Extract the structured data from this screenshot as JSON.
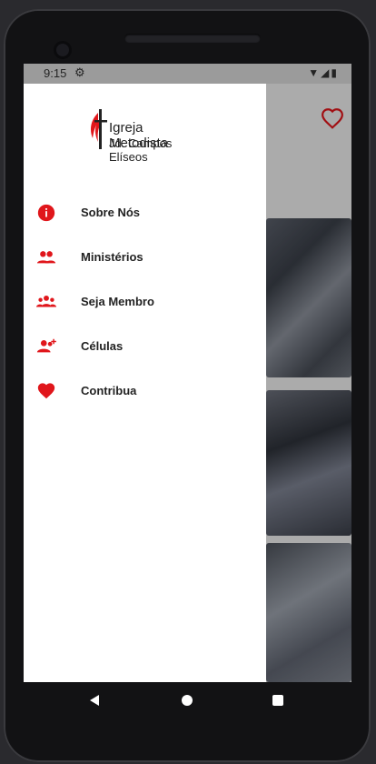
{
  "status": {
    "time": "9:15"
  },
  "logo": {
    "title": "Igreja Metodista",
    "subtitle": "Jd. Campos Elíseos"
  },
  "menu": {
    "items": [
      {
        "label": "Sobre Nós",
        "icon": "info-icon"
      },
      {
        "label": "Ministérios",
        "icon": "people-icon"
      },
      {
        "label": "Seja Membro",
        "icon": "group-icon"
      },
      {
        "label": "Células",
        "icon": "person-add-icon"
      },
      {
        "label": "Contribua",
        "icon": "heart-icon"
      }
    ]
  },
  "colors": {
    "accent": "#e0161b",
    "statusbar": "#d7d7d7"
  }
}
